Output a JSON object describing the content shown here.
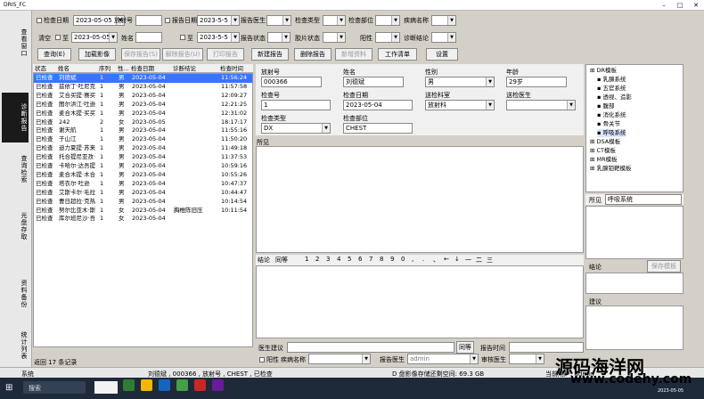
{
  "window": {
    "title": "DRIS_FC",
    "min": "–",
    "max": "□",
    "close": "✕"
  },
  "left_tabs": [
    "查看窗口",
    "诊断报告",
    "查询检索",
    "光盘存取",
    "资料备份",
    "统计列表"
  ],
  "search": {
    "row1": {
      "exam_date_lbl": "检查日期",
      "exam_date": "2023-05-05",
      "film_no_lbl": "放射号",
      "report_date_lbl": "报告日期",
      "report_date": "2023-5-5",
      "report_doc_lbl": "报告医生",
      "exam_type_lbl": "检查类型",
      "exam_site_lbl": "检查部位",
      "disease_lbl": "疾病名称"
    },
    "row2": {
      "clear_lbl": "清空",
      "to_lbl": "至",
      "to_date": "2023-05-05",
      "name_lbl": "姓名",
      "to2_lbl": "至",
      "to_date2": "2023-5-5",
      "report_status_lbl": "报告状态",
      "film_status_lbl": "胶片状态",
      "positive_lbl": "阳性",
      "diag_conclusion_lbl": "诊断结论"
    }
  },
  "toolbar": {
    "query": "查询(E)",
    "load_image": "加载影像",
    "save_report": "保存报告(S)",
    "unlock_report": "解除报告(U)",
    "print_report": "打印报告",
    "new_report": "新建报告",
    "delete_report": "删除报告",
    "new_record": "新增资料",
    "worklist": "工作清单",
    "settings": "设置"
  },
  "list": {
    "headers": [
      "状态",
      "姓名",
      "序列",
      "性...",
      "检查日期",
      "诊断结论",
      "检查时间"
    ],
    "rows": [
      [
        "已检查",
        "刘德斌",
        "1",
        "男",
        "2023-05-04",
        "",
        "11:56:24"
      ],
      [
        "已检查",
        "兹依丁·吐尼克",
        "1",
        "男",
        "2023-05-04",
        "",
        "11:57:58"
      ],
      [
        "已检查",
        "艾合买提·赛买",
        "1",
        "男",
        "2023-05-04",
        "",
        "12:09:27"
      ],
      [
        "已检查",
        "图尔洪江·吐逊",
        "1",
        "男",
        "2023-05-04",
        "",
        "12:21:25"
      ],
      [
        "已检查",
        "麦合木提·买买",
        "1",
        "男",
        "2023-05-04",
        "",
        "12:31:02"
      ],
      [
        "已检查",
        "242",
        "2",
        "女",
        "2023-05-05",
        "",
        "18:17:17"
      ],
      [
        "已检查",
        "谢天航",
        "1",
        "男",
        "2023-05-04",
        "",
        "11:55:16"
      ],
      [
        "已检查",
        "于山江",
        "1",
        "男",
        "2023-05-04",
        "",
        "11:50:20"
      ],
      [
        "已检查",
        "迪力夏提·苏来",
        "1",
        "男",
        "2023-05-04",
        "",
        "11:49:18"
      ],
      [
        "已检查",
        "托合提尼亚孜·",
        "1",
        "男",
        "2023-05-04",
        "",
        "11:37:53"
      ],
      [
        "已检查",
        "卡哈尔·达吾提",
        "1",
        "男",
        "2023-05-04",
        "",
        "10:59:16"
      ],
      [
        "已检查",
        "麦合木提·木合",
        "1",
        "男",
        "2023-05-04",
        "",
        "10:55:26"
      ],
      [
        "已检查",
        "塔衣尔·吐逊",
        "1",
        "男",
        "2023-05-04",
        "",
        "10:47:37"
      ],
      [
        "已检查",
        "艾斯卡尔·毛拉",
        "1",
        "男",
        "2023-05-04",
        "",
        "10:44:47"
      ],
      [
        "已检查",
        "曹日超拉·克热",
        "1",
        "男",
        "2023-05-04",
        "",
        "10:14:54"
      ],
      [
        "已检查",
        "努尔比亚木·斯",
        "1",
        "女",
        "2023-05-04",
        "胸椎陈旧压",
        "10:11:54"
      ],
      [
        "已检查",
        "库尔班尼沙·吾",
        "1",
        "女",
        "2023-05-04",
        "",
        ""
      ]
    ],
    "footer": "返回 17 条记录"
  },
  "form": {
    "film_no_lbl": "放射号",
    "film_no": "000366",
    "name_lbl": "姓名",
    "name": "刘德斌",
    "sex_lbl": "性别",
    "sex": "男",
    "age_lbl": "年龄",
    "age": "29岁",
    "exam_no_lbl": "检查号",
    "exam_no": "1",
    "exam_date_lbl": "检查日期",
    "exam_date": "2023-05-04",
    "dept_lbl": "送检科室",
    "dept": "放射科",
    "doctor_lbl": "送检医生",
    "exam_type_lbl": "检查类型",
    "exam_type": "DX",
    "exam_site_lbl": "检查部位",
    "exam_site": "CHEST"
  },
  "findings_lbl": "所见",
  "conclusion": {
    "lbl": "结论",
    "synonyms": "同等",
    "keys": [
      "1",
      "2",
      "3",
      "4",
      "5",
      "6",
      "7",
      "8",
      "9",
      "0",
      ",",
      ".",
      "、",
      "←",
      "↓",
      "一",
      "二",
      "三"
    ]
  },
  "tree": {
    "items": [
      "DR模板",
      "乳腺系统",
      "五官系统",
      "透视、造影",
      "腹部",
      "消化系统",
      "骨关节",
      "呼吸系统",
      "DSA模板",
      "CT模板",
      "MR模板",
      "乳腺钼靶模板"
    ]
  },
  "right_panel": {
    "sees_lbl": "所见",
    "sees_val": "呼吸系统",
    "conclusion_lbl": "结论",
    "save_tpl": "保存模板",
    "suggest_lbl": "建议"
  },
  "bottom": {
    "doc_suggest_lbl": "医生建议",
    "synonyms_btn": "同等",
    "report_time_lbl": "报告时间",
    "positive_lbl": "阳性",
    "disease_lbl": "疾病名称",
    "report_doc_lbl": "报告医生",
    "report_doc": "admin",
    "review_doc_lbl": "审核医生"
  },
  "status": {
    "sys": "系统",
    "info": "刘德斌 , 000366 , 放射号 , CHEST , 已检查",
    "disk": "D 盘影像存储还剩空间: 69.3 GB",
    "user": "当前用户: admin"
  },
  "watermark": {
    "line1": "源码海洋网",
    "line2": "www.codehy.com"
  },
  "taskbar": {
    "start": "⊞",
    "search": "搜索",
    "time": "2023-05-05"
  }
}
